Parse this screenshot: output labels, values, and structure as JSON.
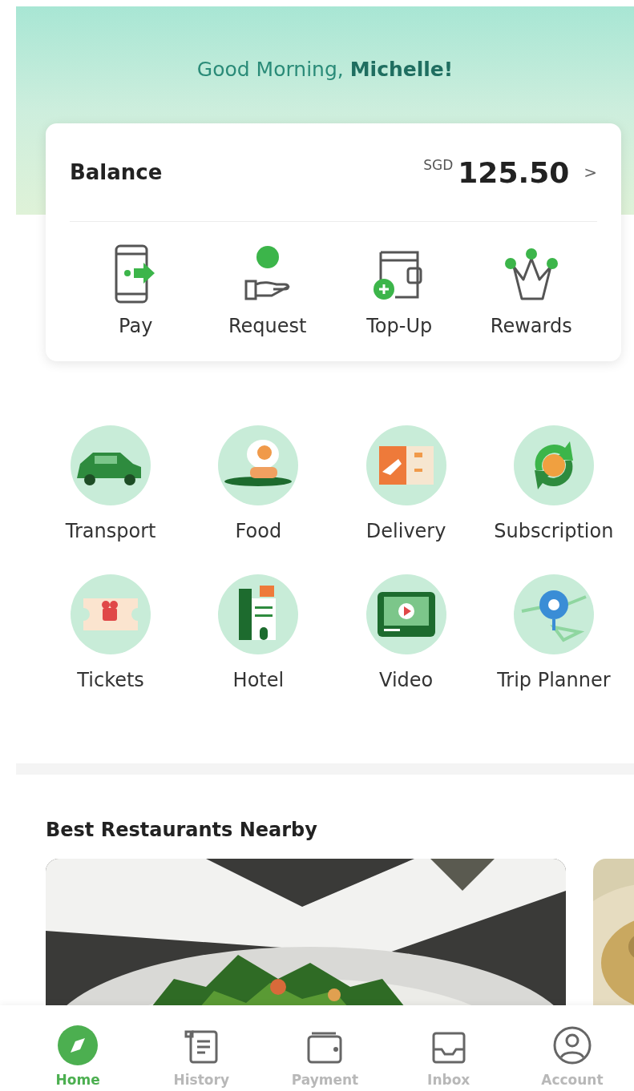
{
  "greeting": "Good Morning, **Michelle!**",
  "balance": {
    "label": "Balance",
    "currency": "SGD",
    "amount": "125.50",
    "chevron": ">"
  },
  "wallet_actions": [
    {
      "label": "Pay"
    },
    {
      "label": "Request"
    },
    {
      "label": "Top-Up"
    },
    {
      "label": "Rewards"
    }
  ],
  "services": [
    {
      "label": "Transport"
    },
    {
      "label": "Food"
    },
    {
      "label": "Delivery"
    },
    {
      "label": "Subscription"
    },
    {
      "label": "Tickets"
    },
    {
      "label": "Hotel"
    },
    {
      "label": "Video"
    },
    {
      "label": "Trip Planner"
    }
  ],
  "section": {
    "title": "Best Restaurants Nearby"
  },
  "nav": [
    {
      "label": "Home",
      "selected": true
    },
    {
      "label": "History",
      "selected": false
    },
    {
      "label": "Payment",
      "selected": false
    },
    {
      "label": "Inbox",
      "selected": false
    },
    {
      "label": "Account",
      "selected": false
    }
  ]
}
